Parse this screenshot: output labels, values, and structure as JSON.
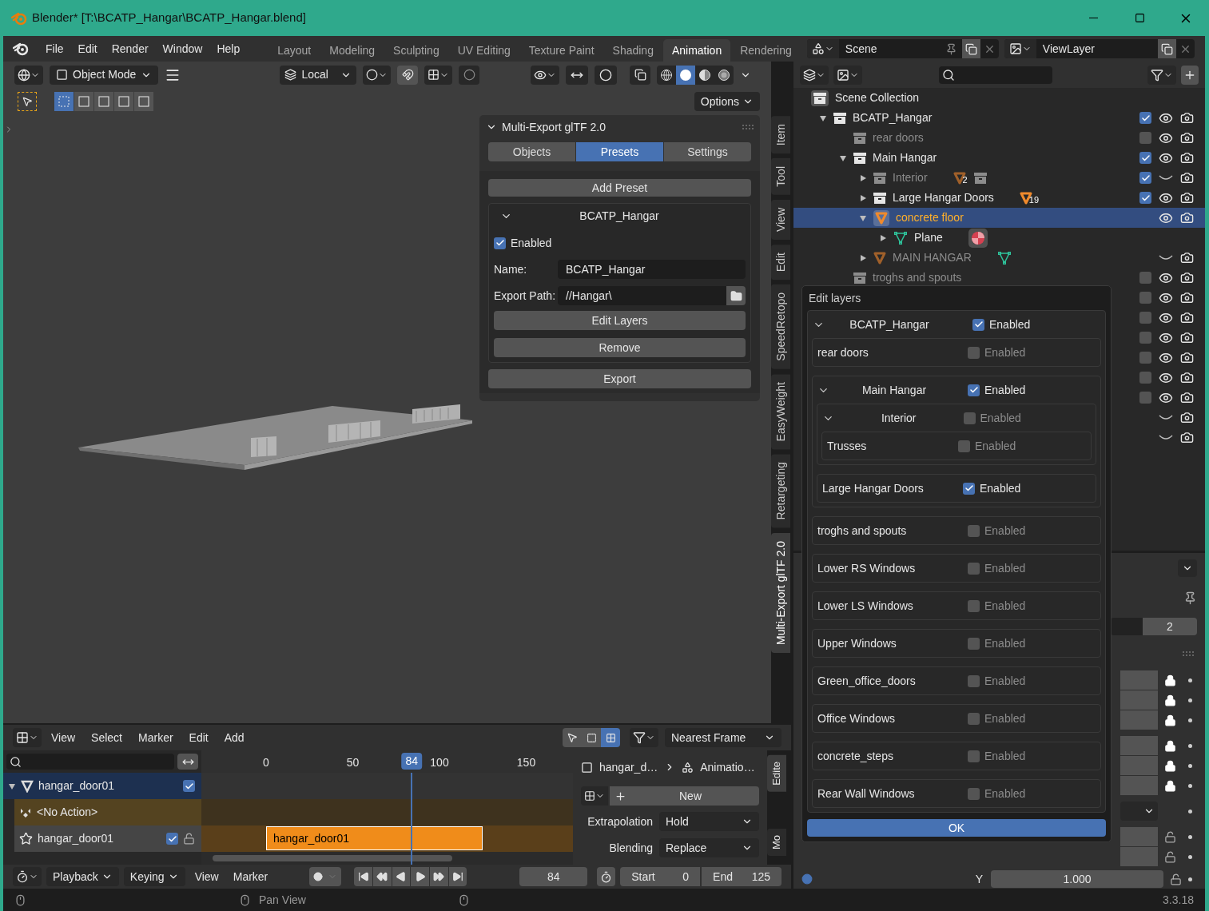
{
  "window": {
    "title": "Blender* [T:\\BCATP_Hangar\\BCATP_Hangar.blend]"
  },
  "menu": [
    "File",
    "Edit",
    "Render",
    "Window",
    "Help"
  ],
  "workspaces": [
    {
      "label": "Layout",
      "selected": false
    },
    {
      "label": "Modeling",
      "selected": false
    },
    {
      "label": "Sculpting",
      "selected": false
    },
    {
      "label": "UV Editing",
      "selected": false
    },
    {
      "label": "Texture Paint",
      "selected": false
    },
    {
      "label": "Shading",
      "selected": false
    },
    {
      "label": "Animation",
      "selected": true
    },
    {
      "label": "Rendering",
      "selected": false
    }
  ],
  "scene": {
    "name": "Scene"
  },
  "view_layer": {
    "name": "ViewLayer"
  },
  "viewport": {
    "mode": "Object Mode",
    "orientation": "Local",
    "options": "Options",
    "select_modes": [
      {
        "selected": true
      },
      {
        "selected": false
      },
      {
        "selected": false
      },
      {
        "selected": false
      },
      {
        "selected": false
      }
    ],
    "shading": [
      {
        "kind": "wireframe",
        "selected": false
      },
      {
        "kind": "solid",
        "selected": true
      },
      {
        "kind": "material",
        "selected": false
      },
      {
        "kind": "rendered",
        "selected": false
      }
    ]
  },
  "sidebar_tabs": [
    {
      "label": "Item",
      "selected": false
    },
    {
      "label": "Tool",
      "selected": false
    },
    {
      "label": "View",
      "selected": false
    },
    {
      "label": "Edit",
      "selected": false
    },
    {
      "label": "SpeedRetopo",
      "selected": false
    },
    {
      "label": "EasyWeight",
      "selected": false
    },
    {
      "label": "Retargeting",
      "selected": false
    },
    {
      "label": "Multi-Export glTF 2.0",
      "selected": true
    }
  ],
  "multi_export": {
    "title": "Multi-Export glTF 2.0",
    "tabs": [
      {
        "label": "Objects",
        "selected": false
      },
      {
        "label": "Presets",
        "selected": true
      },
      {
        "label": "Settings",
        "selected": false
      }
    ],
    "add_preset": "Add Preset",
    "preset": {
      "title": "BCATP_Hangar",
      "expanded": true,
      "enabled": {
        "label": "Enabled",
        "checked": true
      },
      "name_label": "Name:",
      "name": "BCATP_Hangar",
      "path_label": "Export Path:",
      "path": "//Hangar\\",
      "edit_layers": "Edit Layers",
      "remove": "Remove"
    },
    "export": "Export"
  },
  "outliner": {
    "root": "Scene Collection",
    "items": [
      {
        "label": "BCATP_Hangar",
        "kind": "collection",
        "expanded": true,
        "checked": true,
        "visible": true,
        "dimmed": false,
        "selected": false,
        "children": [
          {
            "label": "rear doors",
            "kind": "collection",
            "checked": false,
            "visible": true,
            "dimmed": true,
            "selected": false
          },
          {
            "label": "Main Hangar",
            "kind": "collection",
            "expanded": true,
            "checked": true,
            "visible": true,
            "dimmed": false,
            "selected": false,
            "children": [
              {
                "label": "Interior",
                "kind": "collection",
                "expanded": false,
                "checked": true,
                "visible": false,
                "dimmed": true,
                "selected": false,
                "count": "2",
                "extra": {
                  "kind": "collection"
                }
              },
              {
                "label": "Large Hangar Doors",
                "kind": "collection",
                "expanded": false,
                "checked": true,
                "visible": true,
                "dimmed": false,
                "selected": false,
                "count": "19"
              },
              {
                "label": "concrete floor",
                "kind": "object",
                "expanded": true,
                "visible": true,
                "dimmed": false,
                "selected": true,
                "children": [
                  {
                    "label": "Plane",
                    "kind": "mesh",
                    "expanded": false,
                    "dimmed": false,
                    "selected": false,
                    "extra": {
                      "kind": "material"
                    }
                  }
                ]
              },
              {
                "label": "MAIN HANGAR",
                "kind": "object",
                "expanded": false,
                "visible": false,
                "dimmed": true,
                "selected": false,
                "extra": {
                  "kind": "mesh"
                }
              }
            ]
          },
          {
            "label": "troghs and spouts",
            "kind": "collection",
            "checked": false,
            "visible": true,
            "dimmed": true,
            "selected": false
          }
        ]
      }
    ],
    "covered_rows": [
      {
        "checked": false,
        "visible": true
      },
      {
        "checked": false,
        "visible": true
      },
      {
        "checked": false,
        "visible": true
      },
      {
        "checked": false,
        "visible": true
      },
      {
        "checked": false,
        "visible": true
      },
      {
        "checked": false,
        "visible": true
      },
      {
        "visible": false
      },
      {
        "visible": false
      }
    ]
  },
  "properties": {
    "value": "2",
    "rows": [
      {
        "kind": "lock",
        "locked": true
      },
      {
        "kind": "lock",
        "locked": true
      },
      {
        "kind": "lock",
        "locked": true
      },
      {
        "kind": "lock",
        "locked": true
      },
      {
        "kind": "lock",
        "locked": true
      },
      {
        "kind": "lock",
        "locked": true
      },
      {
        "kind": "dropdown"
      },
      {
        "kind": "lock",
        "locked": false
      },
      {
        "kind": "lock",
        "locked": false
      }
    ],
    "y_label": "Y",
    "y_value": "1.000"
  },
  "edit_layers": {
    "title": "Edit layers",
    "ok": "OK",
    "layers": [
      {
        "label": "BCATP_Hangar",
        "check_label": "Enabled",
        "enabled": true,
        "expanded": true,
        "children": [
          {
            "label": "rear doors",
            "check_label": "Enabled",
            "enabled": false
          },
          {
            "label": "Main Hangar",
            "check_label": "Enabled",
            "enabled": true,
            "expanded": true,
            "children": [
              {
                "label": "Interior",
                "check_label": "Enabled",
                "enabled": false,
                "expanded": true,
                "children": [
                  {
                    "label": "Trusses",
                    "check_label": "Enabled",
                    "enabled": false
                  }
                ]
              },
              {
                "label": "Large Hangar Doors",
                "check_label": "Enabled",
                "enabled": true
              }
            ]
          },
          {
            "label": "troghs and spouts",
            "check_label": "Enabled",
            "enabled": false
          },
          {
            "label": "Lower RS Windows",
            "check_label": "Enabled",
            "enabled": false
          },
          {
            "label": "Lower LS Windows",
            "check_label": "Enabled",
            "enabled": false
          },
          {
            "label": "Upper Windows",
            "check_label": "Enabled",
            "enabled": false
          },
          {
            "label": "Green_office_doors",
            "check_label": "Enabled",
            "enabled": false
          },
          {
            "label": "Office Windows",
            "check_label": "Enabled",
            "enabled": false
          },
          {
            "label": "concrete_steps",
            "check_label": "Enabled",
            "enabled": false
          },
          {
            "label": "Rear Wall Windows",
            "check_label": "Enabled",
            "enabled": false
          }
        ]
      }
    ]
  },
  "timeline": {
    "menus": [
      "View",
      "Select",
      "Marker",
      "Edit",
      "Add"
    ],
    "snap": "Nearest Frame",
    "ruler": [
      "0",
      "50",
      "100",
      "150"
    ],
    "current_frame": "84",
    "channels": [
      {
        "kind": "object",
        "label": "hangar_door01",
        "expanded": true,
        "checked": true
      },
      {
        "kind": "action",
        "label": "<No Action>"
      },
      {
        "kind": "track",
        "label": "hangar_door01",
        "checked": true
      }
    ],
    "strip": "hangar_door01",
    "sidebar": {
      "object": "hangar_d…",
      "action": "Animatio…",
      "new": "New",
      "extrapolation_label": "Extrapolation",
      "extrapolation": "Hold",
      "blending_label": "Blending",
      "blending": "Replace"
    },
    "tabs": [
      "Edite",
      "Mo"
    ]
  },
  "playback": {
    "menus": [
      "Playback",
      "Keying"
    ],
    "links": [
      "View",
      "Marker"
    ],
    "frame": "84",
    "start_label": "Start",
    "start": "0",
    "end_label": "End",
    "end": "125"
  },
  "status_bar": {
    "hint": "Pan View",
    "version": "3.3.18"
  }
}
